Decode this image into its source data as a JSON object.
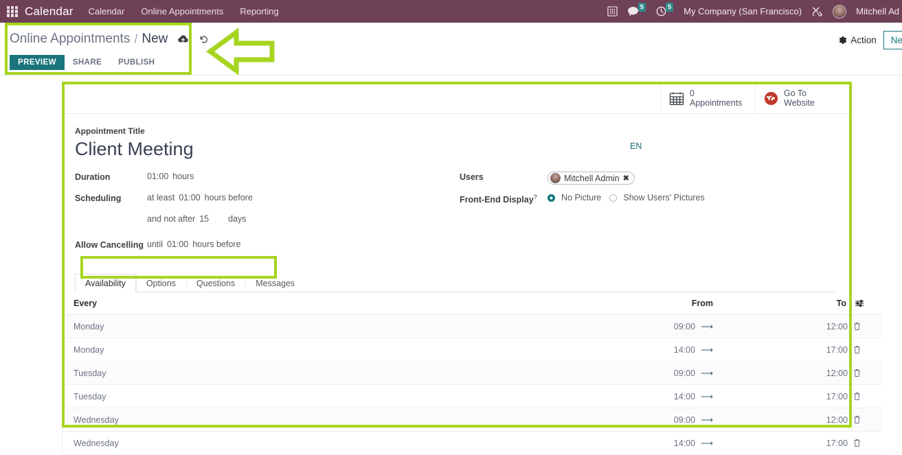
{
  "navbar": {
    "apps_icon": "apps-grid-icon",
    "brand": "Calendar",
    "menu": [
      "Calendar",
      "Online Appointments",
      "Reporting"
    ],
    "icons": {
      "dialpad": "dialpad-icon",
      "messages": "chat-bubble-icon",
      "activities": "clock-icon"
    },
    "messages_count": "5",
    "activities_count": "5",
    "company": "My Company (San Francisco)",
    "tools_icon": "wrench-screwdriver-icon",
    "user": "Mitchell Ad",
    "accent_purple": "#6F4156",
    "badge_color": "#2E8B8B"
  },
  "control_panel": {
    "breadcrumb_parent": "Online Appointments",
    "breadcrumb_sep": "/",
    "breadcrumb_current": "New",
    "save_icon": "cloud-upload-icon",
    "discard_icon": "undo-icon",
    "buttons": {
      "preview": "PREVIEW",
      "share": "SHARE",
      "publish": "PUBLISH"
    },
    "action_label": "Action",
    "action_icon": "gear-icon",
    "new_label": "Ne",
    "accent_teal": "#19757B"
  },
  "stat_buttons": [
    {
      "icon": "calendar-icon",
      "value": "0",
      "label": "Appointments"
    },
    {
      "icon": "globe-icon",
      "value": "Go To",
      "label": "Website"
    }
  ],
  "form": {
    "title_label": "Appointment Title",
    "title_value": "Client Meeting",
    "language_badge": "EN",
    "left_fields": [
      {
        "label": "Duration",
        "parts": [
          {
            "type": "value",
            "text": "01:00"
          },
          {
            "type": "text",
            "text": "hours"
          }
        ]
      },
      {
        "label": "Scheduling",
        "parts": [
          {
            "type": "text",
            "text": "at least"
          },
          {
            "type": "value",
            "text": "01:00"
          },
          {
            "type": "text",
            "text": "hours before"
          }
        ]
      },
      {
        "label": "",
        "parts": [
          {
            "type": "text",
            "text": "and not after"
          },
          {
            "type": "value",
            "text": "15"
          },
          {
            "type": "text",
            "text": "days"
          }
        ]
      },
      {
        "label": "Allow Cancelling",
        "parts": [
          {
            "type": "text",
            "text": "until"
          },
          {
            "type": "value",
            "text": "01:00"
          },
          {
            "type": "text",
            "text": "hours before"
          }
        ]
      }
    ],
    "users_label": "Users",
    "users_tag": "Mitchell Admin",
    "users_tag_remove": "✖",
    "frontend_label": "Front-End Display",
    "frontend_help": "?",
    "frontend_options": [
      {
        "label": "No Picture",
        "selected": true
      },
      {
        "label": "Show Users' Pictures",
        "selected": false
      }
    ]
  },
  "notebook": {
    "tabs": [
      {
        "label": "Availability",
        "active": true
      },
      {
        "label": "Options",
        "active": false
      },
      {
        "label": "Questions",
        "active": false
      },
      {
        "label": "Messages",
        "active": false
      }
    ]
  },
  "slots_table": {
    "columns": {
      "every": "Every",
      "from": "From",
      "to": "To",
      "options_icon": "column-options-icon"
    },
    "row_icons": {
      "arrow": "arrow-right-icon",
      "delete": "trash-icon"
    },
    "rows": [
      {
        "every": "Monday",
        "from": "09:00",
        "to": "12:00"
      },
      {
        "every": "Monday",
        "from": "14:00",
        "to": "17:00"
      },
      {
        "every": "Tuesday",
        "from": "09:00",
        "to": "12:00"
      },
      {
        "every": "Tuesday",
        "from": "14:00",
        "to": "17:00"
      },
      {
        "every": "Wednesday",
        "from": "09:00",
        "to": "12:00"
      },
      {
        "every": "Wednesday",
        "from": "14:00",
        "to": "17:00"
      }
    ]
  },
  "annotations": {
    "highlight_color": "#A6D520",
    "arrow_icon": "left-arrow-annotation"
  }
}
